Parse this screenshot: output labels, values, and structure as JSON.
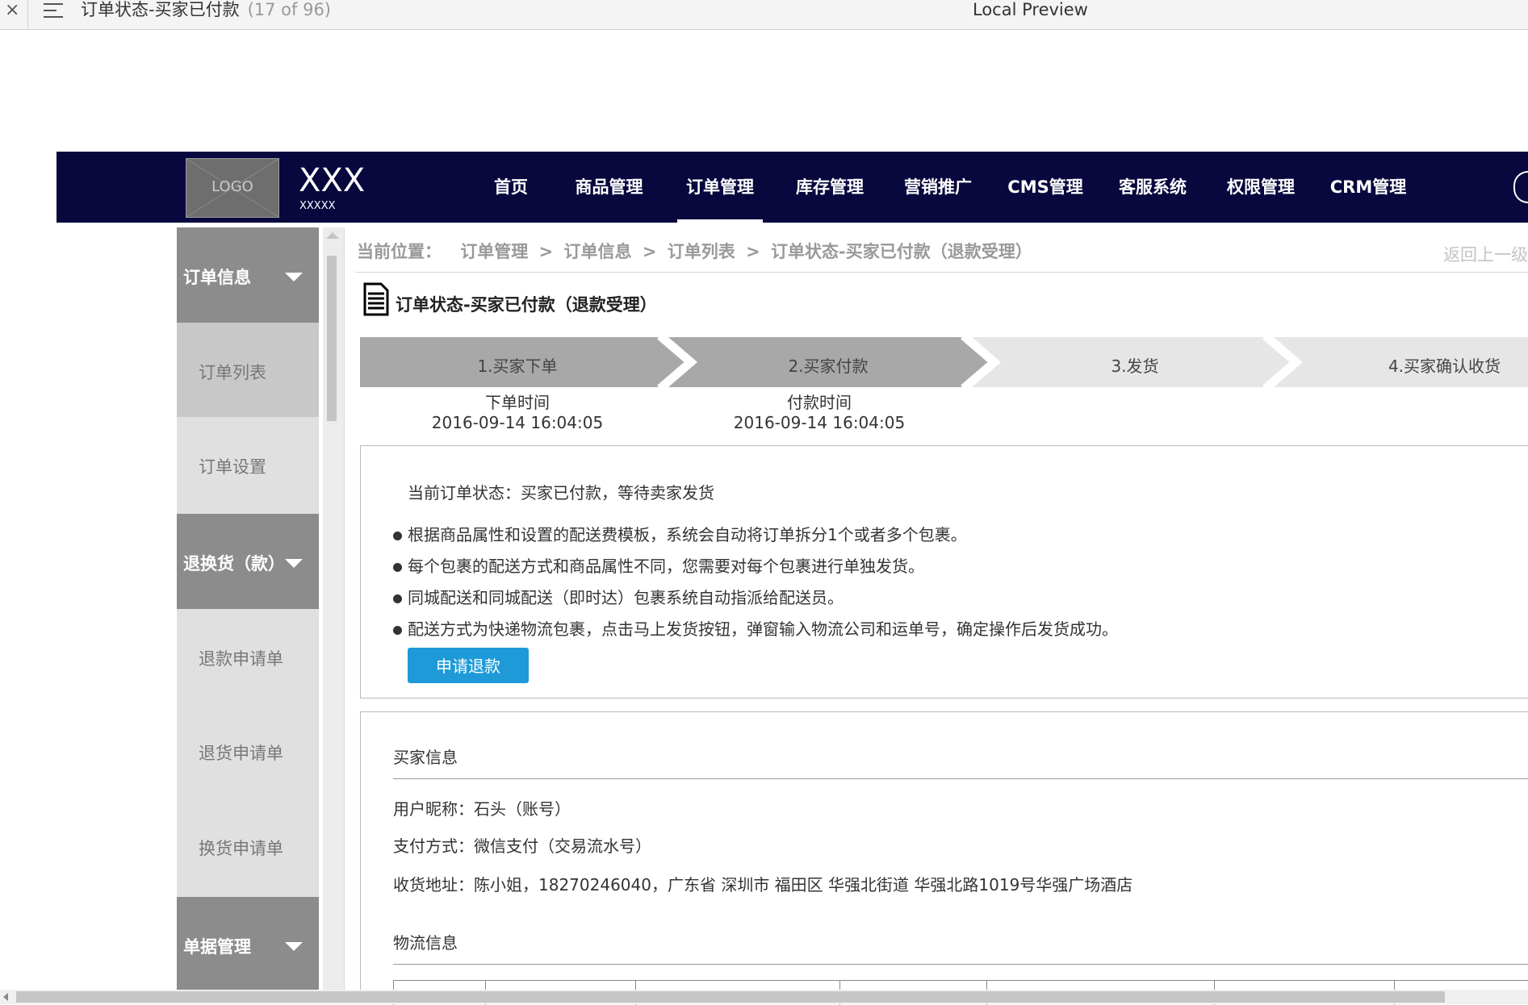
{
  "window": {
    "title": "订单状态-买家已付款",
    "page_count": "(17 of 96)",
    "center_title": "Local Preview"
  },
  "header": {
    "logo_text": "LOGO",
    "site_name": "XXX",
    "site_sub": "XXXXX",
    "nav": [
      "首页",
      "商品管理",
      "订单管理",
      "库存管理",
      "营销推广",
      "CMS管理",
      "客服系统",
      "权限管理",
      "CRM管理"
    ],
    "active_nav": "订单管理"
  },
  "sidebar": {
    "groups": [
      {
        "label": "订单信息",
        "items": [
          "订单列表",
          "订单设置"
        ]
      },
      {
        "label": "退换货（款）",
        "items": [
          "退款申请单",
          "退货申请单",
          "换货申请单"
        ]
      },
      {
        "label": "单据管理",
        "items": []
      }
    ],
    "selected_item": "订单列表"
  },
  "breadcrumb": {
    "prefix": "当前位置：",
    "items": [
      "订单管理",
      "订单信息",
      "订单列表",
      "订单状态-买家已付款（退款受理）"
    ],
    "separator": ">",
    "back_link": "返回上一级"
  },
  "page": {
    "title": "订单状态-买家已付款（退款受理）"
  },
  "steps": [
    {
      "label": "1.买家下单",
      "time_label": "下单时间",
      "time": "2016-09-14 16:04:05"
    },
    {
      "label": "2.买家付款",
      "time_label": "付款时间",
      "time": "2016-09-14 16:04:05"
    },
    {
      "label": "3.发货"
    },
    {
      "label": "4.买家确认收货"
    }
  ],
  "status": {
    "current": "当前订单状态：买家已付款，等待卖家发货",
    "tips": [
      "根据商品属性和设置的配送费模板，系统会自动将订单拆分1个或者多个包裹。",
      "每个包裹的配送方式和商品属性不同，您需要对每个包裹进行单独发货。",
      "同城配送和同城配送（即时达）包裹系统自动指派给配送员。",
      "配送方式为快递物流包裹，点击马上发货按钮，弹窗输入物流公司和运单号，确定操作后发货成功。"
    ],
    "refund_button": "申请退款"
  },
  "buyer": {
    "section_title": "买家信息",
    "nickname": "用户昵称：石头（账号）",
    "payment": "支付方式：微信支付（交易流水号）",
    "address": "收货地址：陈小姐，18270246040，广东省 深圳市 福田区 华强北街道 华强北路1019号华强广场酒店"
  },
  "logistics": {
    "section_title": "物流信息"
  },
  "colors": {
    "header_bg": "#08083e",
    "primary_button": "#1e9ad8",
    "step_done": "#a8a8a8",
    "step_todo": "#e6e6e6"
  }
}
